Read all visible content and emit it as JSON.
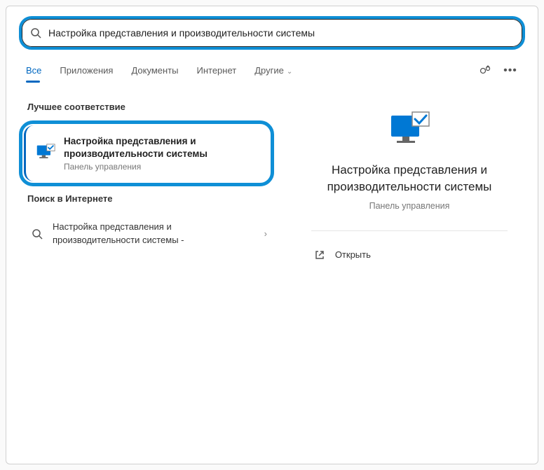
{
  "search": {
    "query": "Настройка представления и производительности системы"
  },
  "tabs": {
    "all": "Все",
    "apps": "Приложения",
    "documents": "Документы",
    "web": "Интернет",
    "more": "Другие"
  },
  "sections": {
    "best_match": "Лучшее соответствие",
    "web_search": "Поиск в Интернете"
  },
  "results": {
    "best": {
      "title": "Настройка представления и производительности системы",
      "category": "Панель управления"
    },
    "web": {
      "title": "Настройка представления и производительности системы -"
    }
  },
  "preview": {
    "title": "Настройка представления и производительности системы",
    "category": "Панель управления",
    "actions": {
      "open": "Открыть"
    }
  }
}
